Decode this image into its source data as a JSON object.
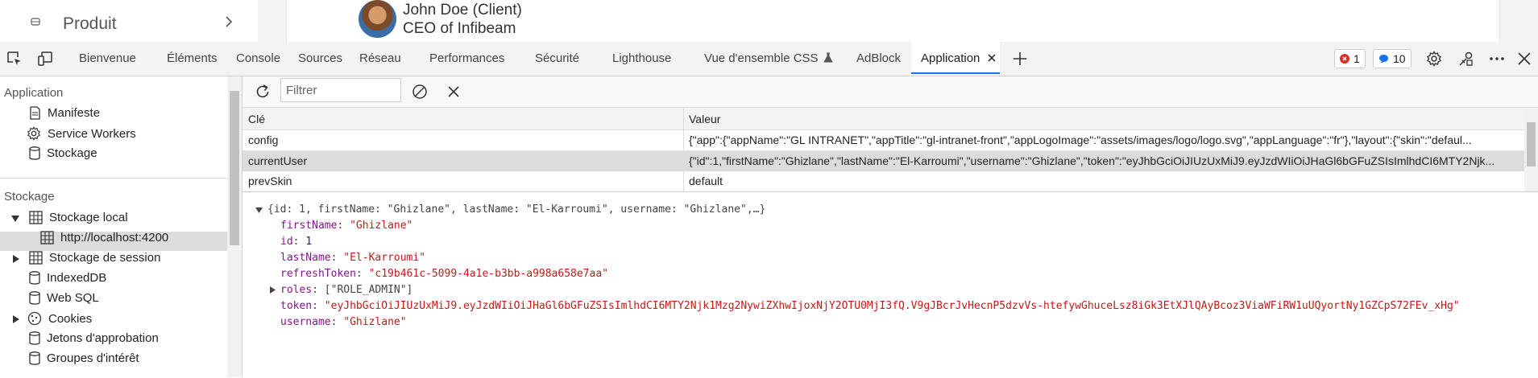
{
  "page": {
    "sidebar_item": "Produit",
    "client_name": "John Doe (Client)",
    "client_role": "CEO of Infibeam"
  },
  "tabs": [
    "Bienvenue",
    "Éléments",
    "Console",
    "Sources",
    "Réseau",
    "Performances",
    "Sécurité",
    "Lighthouse",
    "Vue d'ensemble CSS",
    "AdBlock",
    "Application"
  ],
  "badges": {
    "errors": "1",
    "messages": "10"
  },
  "left": {
    "section_app": "Application",
    "app_items": [
      "Manifeste",
      "Service Workers",
      "Stockage"
    ],
    "section_storage": "Stockage",
    "storage_items": [
      "Stockage local",
      "http://localhost:4200",
      "Stockage de session",
      "IndexedDB",
      "Web SQL",
      "Cookies",
      "Jetons d'approbation",
      "Groupes d'intérêt"
    ]
  },
  "toolbar": {
    "filter_placeholder": "Filtrer"
  },
  "table": {
    "headers": [
      "Clé",
      "Valeur"
    ],
    "rows": [
      {
        "key": "config",
        "value": "{\"app\":{\"appName\":\"GL INTRANET\",\"appTitle\":\"gl-intranet-front\",\"appLogoImage\":\"assets/images/logo/logo.svg\",\"appLanguage\":\"fr\"},\"layout\":{\"skin\":\"defaul..."
      },
      {
        "key": "currentUser",
        "value": "{\"id\":1,\"firstName\":\"Ghizlane\",\"lastName\":\"El-Karroumi\",\"username\":\"Ghizlane\",\"token\":\"eyJhbGciOiJIUzUxMiJ9.eyJzdWIiOiJHaGl6bGFuZSIsImlhdCI6MTY2Njk..."
      },
      {
        "key": "prevSkin",
        "value": "default"
      }
    ]
  },
  "json": {
    "summary": "{id: 1, firstName: \"Ghizlane\", lastName: \"El-Karroumi\", username: \"Ghizlane\",…}",
    "lines": [
      {
        "k": "firstName",
        "v": "\"Ghizlane\"",
        "t": "s"
      },
      {
        "k": "id",
        "v": "1",
        "t": "n"
      },
      {
        "k": "lastName",
        "v": "\"El-Karroumi\"",
        "t": "s"
      },
      {
        "k": "refreshToken",
        "v": "\"c19b461c-5099-4a1e-b3bb-a998a658e7aa\"",
        "t": "s"
      },
      {
        "k": "roles",
        "v": "[\"ROLE_ADMIN\"]",
        "t": "p"
      },
      {
        "k": "token",
        "v": "\"eyJhbGciOiJIUzUxMiJ9.eyJzdWIiOiJHaGl6bGFuZSIsImlhdCI6MTY2Njk1Mzg2NywiZXhwIjoxNjY2OTU0MjI3fQ.V9gJBcrJvHecnP5dzvVs-htefywGhuceLsz8iGk3EtXJlQAyBcoz3ViaWFiRW1uUQyortNy1GZCpS72FEv_xHg\"",
        "t": "s"
      },
      {
        "k": "username",
        "v": "\"Ghizlane\"",
        "t": "s"
      }
    ]
  }
}
